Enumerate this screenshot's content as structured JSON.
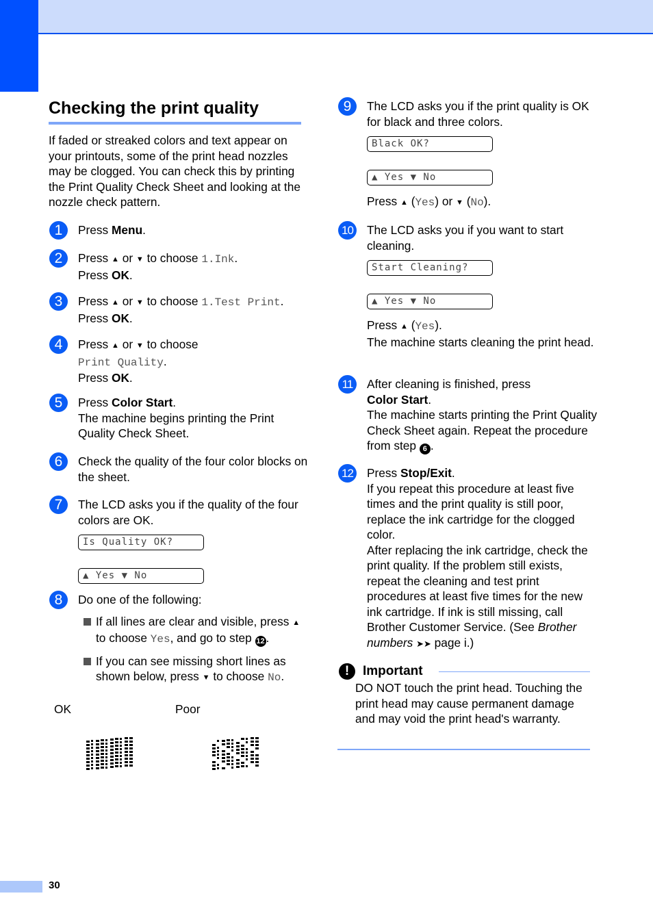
{
  "page": {
    "number": "30"
  },
  "section": {
    "title": "Checking the print quality",
    "intro": "If faded or streaked colors and text appear on your printouts, some of the print head nozzles may be clogged. You can check this by printing the Print Quality Check Sheet and looking at the nozzle check pattern."
  },
  "common": {
    "press": "Press",
    "or": "or",
    "to_choose": "to choose",
    "ok": "OK",
    "up_arrow": "▲",
    "down_arrow": "▼",
    "yes": "Yes",
    "no": "No",
    "lcd_yes_no": "▲ Yes ▼ No"
  },
  "steps": [
    {
      "n": "1",
      "key": "Menu"
    },
    {
      "n": "2",
      "option": "1.Ink"
    },
    {
      "n": "3",
      "option": "1.Test Print"
    },
    {
      "n": "4",
      "option": "Print Quality"
    },
    {
      "n": "5",
      "key": "Color Start",
      "text": "The machine begins printing the Print Quality Check Sheet."
    },
    {
      "n": "6",
      "text": "Check the quality of the four color blocks on the sheet."
    },
    {
      "n": "7",
      "text": "The LCD asks you if the quality of the four colors are OK.",
      "lcd": "Is Quality OK?"
    },
    {
      "n": "8",
      "text": "Do one of the following:",
      "bullets": [
        {
          "a": "If all lines are clear and visible, press",
          "b": "to choose",
          "c": ", and go to step",
          "ref": "12"
        },
        {
          "a": "If you can see missing short lines as shown below, press",
          "b": "to choose"
        }
      ]
    },
    {
      "n": "9",
      "text": "The LCD asks you if the print quality is OK for black and three colors.",
      "lcd": "Black OK?"
    },
    {
      "n": "10",
      "text": "The LCD asks you if you want to start cleaning.",
      "lcd": "Start Cleaning?",
      "after": "The machine starts cleaning the print head."
    },
    {
      "n": "11",
      "text": "After cleaning is finished, press",
      "key": "Color Start",
      "after": "The machine starts printing the Print Quality Check Sheet again. Repeat the procedure from step",
      "ref": "6"
    },
    {
      "n": "12",
      "key": "Stop/Exit",
      "after": "If you repeat this procedure at least five times and the print quality is still poor, replace the ink cartridge for the clogged color.",
      "after2": "After replacing the ink cartridge, check the print quality. If the problem still exists, repeat the cleaning and test print procedures at least five times for the new ink cartridge. If ink is still missing, call Brother Customer Service. (See",
      "link": "Brother numbers",
      "link_arrows": "➤➤",
      "page_ref": "page i.)"
    }
  ],
  "samples": {
    "ok_label": "OK",
    "poor_label": "Poor"
  },
  "important": {
    "icon": "exclamation-icon",
    "title": "Important",
    "body": "DO NOT touch the print head. Touching the print head may cause permanent damage and may void the print head's warranty."
  },
  "colors": {
    "accent": "#0050ff",
    "band": "#ccdcfc",
    "rule": "#7ea6f8",
    "step_circle": "#0a5cf5"
  }
}
